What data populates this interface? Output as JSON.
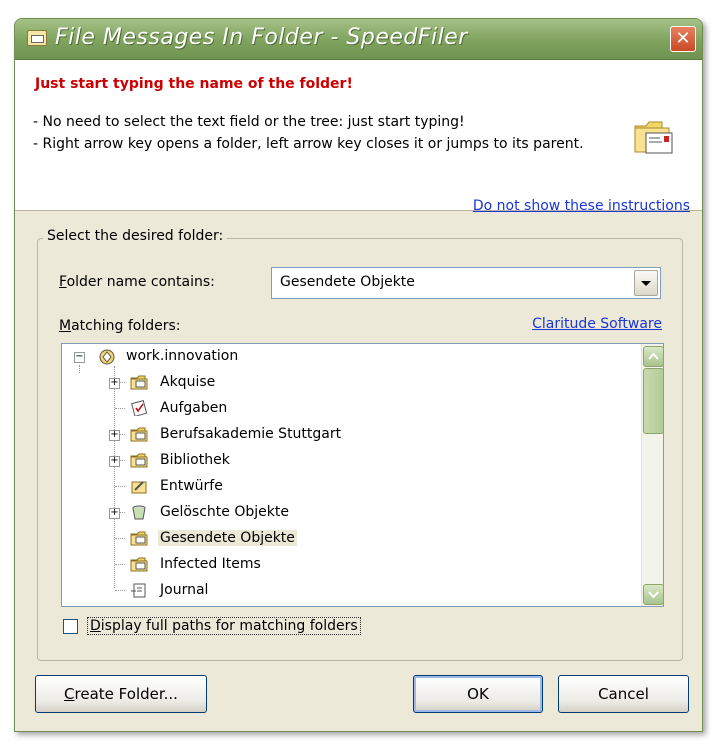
{
  "window": {
    "title": "File Messages In Folder - SpeedFiler",
    "close_glyph": "✕"
  },
  "instructions": {
    "heading": "Just start typing the name of the folder!",
    "line1": "- No need to select the text field or the tree: just start typing!",
    "line2": "- Right arrow key opens a folder, left arrow key closes it or jumps to its parent.",
    "hide_link": "Do not show these instructions"
  },
  "group": {
    "label": "Select the desired folder:"
  },
  "folder_filter": {
    "label_accel": "F",
    "label_rest": "older name contains:",
    "value": "Gesendete Objekte"
  },
  "matching": {
    "label_accel": "M",
    "label_rest": "atching folders:",
    "link": "Claritude Software"
  },
  "tree": {
    "root": "work.innovation",
    "items": [
      {
        "label": "Akquise",
        "expandable": true,
        "icon": "folder-icon"
      },
      {
        "label": "Aufgaben",
        "expandable": false,
        "icon": "tasks-icon"
      },
      {
        "label": "Berufsakademie Stuttgart",
        "expandable": true,
        "icon": "folder-icon"
      },
      {
        "label": "Bibliothek",
        "expandable": true,
        "icon": "folder-icon"
      },
      {
        "label": "Entwürfe",
        "expandable": false,
        "icon": "drafts-icon"
      },
      {
        "label": "Gelöschte Objekte",
        "expandable": true,
        "icon": "trash-icon"
      },
      {
        "label": "Gesendete Objekte",
        "expandable": false,
        "icon": "sent-folder-icon",
        "selected": true
      },
      {
        "label": "Infected Items",
        "expandable": false,
        "icon": "folder-icon"
      },
      {
        "label": "Journal",
        "expandable": false,
        "icon": "journal-icon"
      }
    ]
  },
  "options": {
    "full_paths_accel": "D",
    "full_paths_rest": "isplay full paths for matching folders",
    "full_paths_checked": false
  },
  "buttons": {
    "create_accel": "C",
    "create_rest": "reate Folder...",
    "ok": "OK",
    "cancel": "Cancel"
  },
  "colors": {
    "titlebar": "#7fa35f",
    "heading_red": "#cc0000",
    "link_blue": "#1a35d8",
    "dialog_bg": "#ECE9D8"
  }
}
